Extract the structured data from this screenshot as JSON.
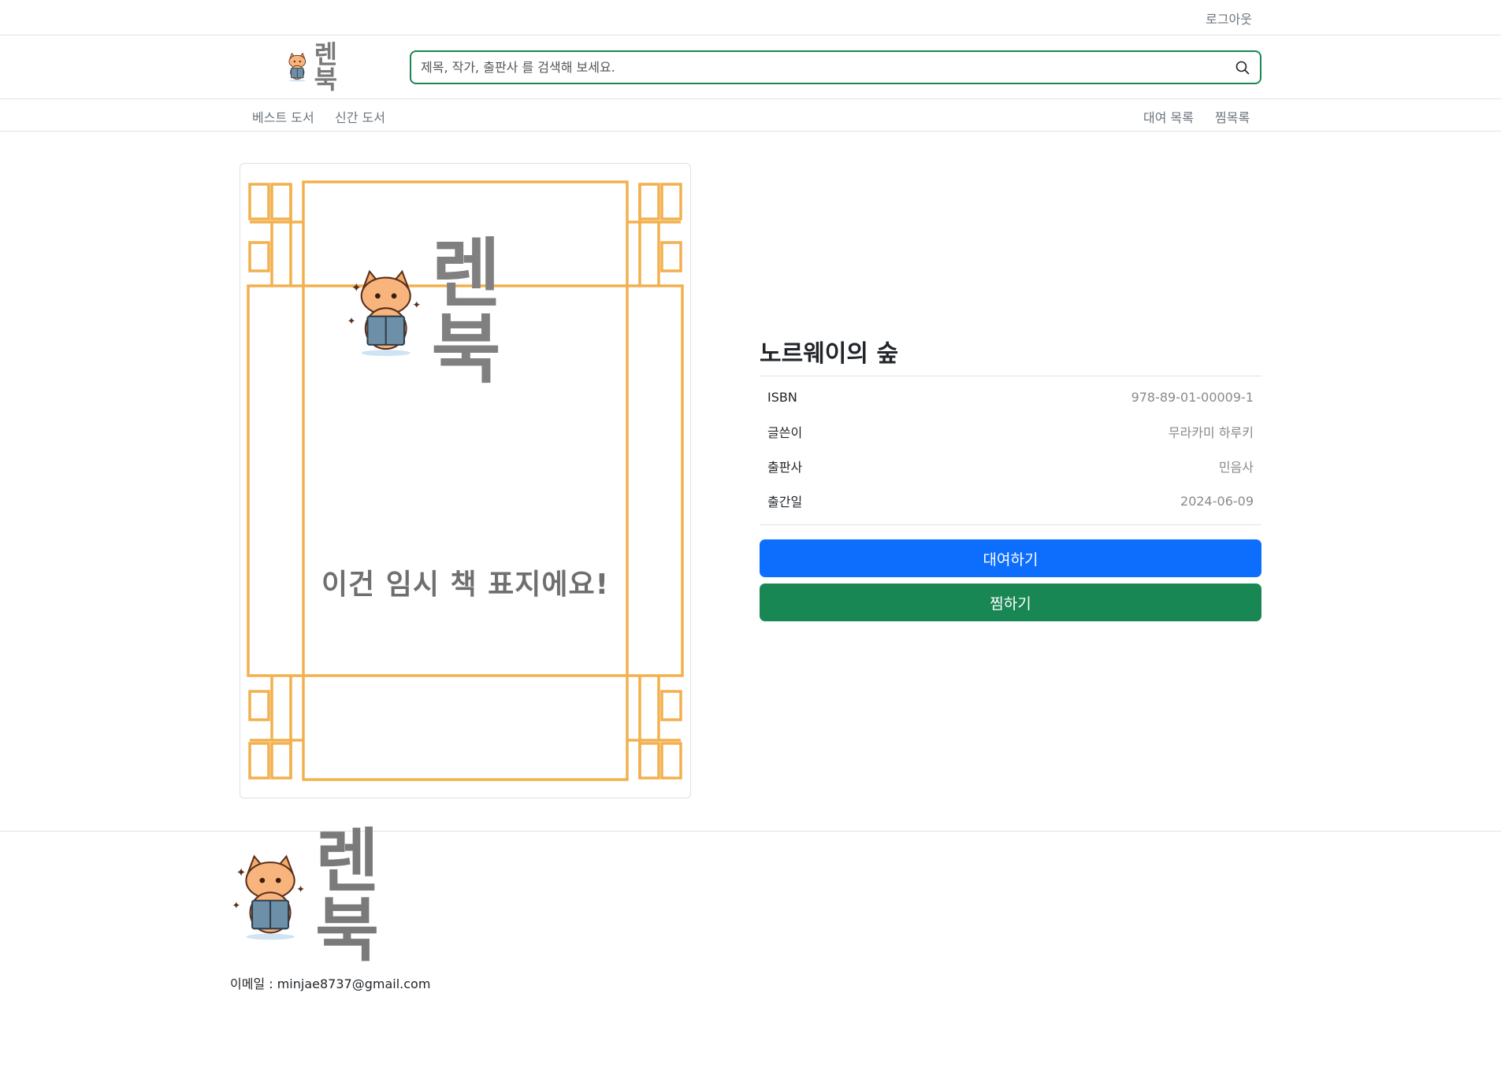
{
  "topbar": {
    "logout_label": "로그아웃"
  },
  "header": {
    "brand_text": "렌 북",
    "search": {
      "placeholder": "제목, 작가, 출판사 를 검색해 보세요.",
      "value": ""
    },
    "search_icon": "search-icon"
  },
  "nav": {
    "best_label": "베스트 도서",
    "new_label": "신간 도서",
    "rental_label": "대여 목록",
    "wishlist_label": "찜목록"
  },
  "cover": {
    "logo_text": "렌 북",
    "caption": "이건 임시 책 표지에요!",
    "frame_color": "#f2b04e"
  },
  "book": {
    "title": "노르웨이의 숲",
    "details": [
      {
        "label": "ISBN",
        "value": "978-89-01-00009-1"
      },
      {
        "label": "글쓴이",
        "value": "무라카미 하루키"
      },
      {
        "label": "출판사",
        "value": "민음사"
      },
      {
        "label": "출간일",
        "value": "2024-06-09"
      }
    ]
  },
  "actions": {
    "rent_label": "대여하기",
    "wish_label": "찜하기",
    "rent_color": "#0d6efd",
    "wish_color": "#198754"
  },
  "footer": {
    "logo_text": "렌 북",
    "email_text": "이메일 : minjae8737@gmail.com"
  }
}
